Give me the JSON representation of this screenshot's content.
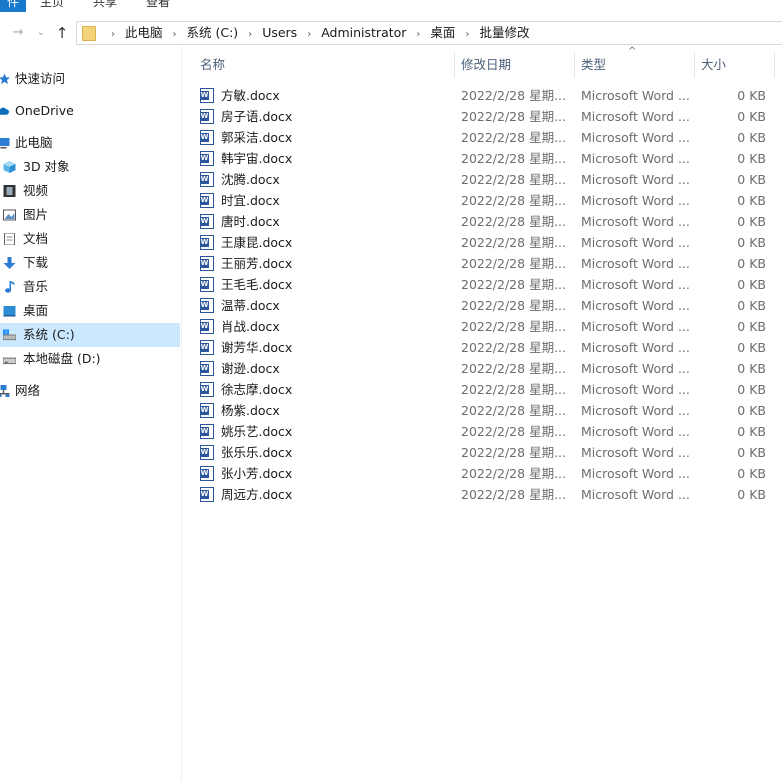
{
  "ribbon": {
    "tabs": [
      "件",
      "主页",
      "共享",
      "查看"
    ]
  },
  "nav": {
    "back_glyph": "→",
    "forward_glyph": "⌄",
    "up_glyph": "↑"
  },
  "breadcrumb": [
    "此电脑",
    "系统 (C:)",
    "Users",
    "Administrator",
    "桌面",
    "批量修改"
  ],
  "breadcrumb_sep": "›",
  "sidebar": {
    "items": [
      {
        "label": "快速访问",
        "icon": "star-icon"
      },
      {
        "label": "OneDrive",
        "icon": "cloud-icon"
      },
      {
        "label": "此电脑",
        "icon": "computer-icon"
      },
      {
        "label": "3D 对象",
        "icon": "cube-icon"
      },
      {
        "label": "视频",
        "icon": "film-icon"
      },
      {
        "label": "图片",
        "icon": "picture-icon"
      },
      {
        "label": "文档",
        "icon": "document-icon"
      },
      {
        "label": "下载",
        "icon": "download-icon"
      },
      {
        "label": "音乐",
        "icon": "music-icon"
      },
      {
        "label": "桌面",
        "icon": "desktop-icon"
      },
      {
        "label": "系统 (C:)",
        "icon": "drive-c-icon"
      },
      {
        "label": "本地磁盘 (D:)",
        "icon": "drive-d-icon"
      },
      {
        "label": "网络",
        "icon": "network-icon"
      }
    ],
    "selected": "系统 (C:)"
  },
  "columns": {
    "name": "名称",
    "date": "修改日期",
    "type": "类型",
    "size": "大小",
    "sort_glyph": "^"
  },
  "files": [
    {
      "name": "方敏.docx",
      "date": "2022/2/28 星期...",
      "type": "Microsoft Word ...",
      "size": "0 KB"
    },
    {
      "name": "房子语.docx",
      "date": "2022/2/28 星期...",
      "type": "Microsoft Word ...",
      "size": "0 KB"
    },
    {
      "name": "郭采洁.docx",
      "date": "2022/2/28 星期...",
      "type": "Microsoft Word ...",
      "size": "0 KB"
    },
    {
      "name": "韩宇宙.docx",
      "date": "2022/2/28 星期...",
      "type": "Microsoft Word ...",
      "size": "0 KB"
    },
    {
      "name": "沈腾.docx",
      "date": "2022/2/28 星期...",
      "type": "Microsoft Word ...",
      "size": "0 KB"
    },
    {
      "name": "时宜.docx",
      "date": "2022/2/28 星期...",
      "type": "Microsoft Word ...",
      "size": "0 KB"
    },
    {
      "name": "唐时.docx",
      "date": "2022/2/28 星期...",
      "type": "Microsoft Word ...",
      "size": "0 KB"
    },
    {
      "name": "王康昆.docx",
      "date": "2022/2/28 星期...",
      "type": "Microsoft Word ...",
      "size": "0 KB"
    },
    {
      "name": "王丽芳.docx",
      "date": "2022/2/28 星期...",
      "type": "Microsoft Word ...",
      "size": "0 KB"
    },
    {
      "name": "王毛毛.docx",
      "date": "2022/2/28 星期...",
      "type": "Microsoft Word ...",
      "size": "0 KB"
    },
    {
      "name": "温蒂.docx",
      "date": "2022/2/28 星期...",
      "type": "Microsoft Word ...",
      "size": "0 KB"
    },
    {
      "name": "肖战.docx",
      "date": "2022/2/28 星期...",
      "type": "Microsoft Word ...",
      "size": "0 KB"
    },
    {
      "name": "谢芳华.docx",
      "date": "2022/2/28 星期...",
      "type": "Microsoft Word ...",
      "size": "0 KB"
    },
    {
      "name": "谢逊.docx",
      "date": "2022/2/28 星期...",
      "type": "Microsoft Word ...",
      "size": "0 KB"
    },
    {
      "name": "徐志摩.docx",
      "date": "2022/2/28 星期...",
      "type": "Microsoft Word ...",
      "size": "0 KB"
    },
    {
      "name": "杨紫.docx",
      "date": "2022/2/28 星期...",
      "type": "Microsoft Word ...",
      "size": "0 KB"
    },
    {
      "name": "姚乐艺.docx",
      "date": "2022/2/28 星期...",
      "type": "Microsoft Word ...",
      "size": "0 KB"
    },
    {
      "name": "张乐乐.docx",
      "date": "2022/2/28 星期...",
      "type": "Microsoft Word ...",
      "size": "0 KB"
    },
    {
      "name": "张小芳.docx",
      "date": "2022/2/28 星期...",
      "type": "Microsoft Word ...",
      "size": "0 KB"
    },
    {
      "name": "周远方.docx",
      "date": "2022/2/28 星期...",
      "type": "Microsoft Word ...",
      "size": "0 KB"
    }
  ],
  "colors": {
    "accent": "#1979ca",
    "selected_bg": "#cce8ff",
    "header_text": "#4c607a",
    "word_blue": "#2b579a"
  }
}
